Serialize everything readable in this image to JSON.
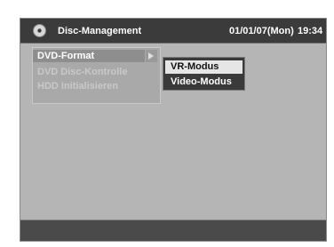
{
  "header": {
    "icon": "disc-icon",
    "title": "Disc-Management",
    "date": "01/01/07(Mon)",
    "time": "19:34"
  },
  "menu": {
    "items": [
      {
        "label": "DVD-Format",
        "state": "selected"
      },
      {
        "label": "DVD Disc-Kontrolle",
        "state": "disabled"
      },
      {
        "label": "HDD Initialisieren",
        "state": "disabled"
      }
    ]
  },
  "submenu": {
    "items": [
      {
        "label": "VR-Modus",
        "state": "selected"
      },
      {
        "label": "Video-Modus",
        "state": "normal"
      }
    ]
  },
  "colors": {
    "background": "#b5b5b5",
    "titlebar": "#3b3b3b",
    "highlight": "#e6e6e6"
  }
}
